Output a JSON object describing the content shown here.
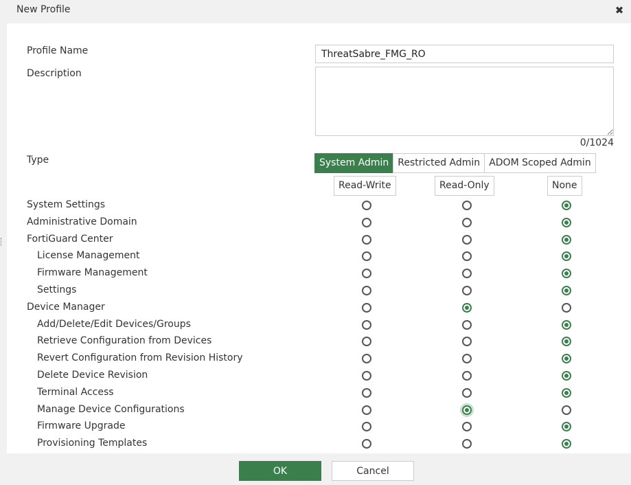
{
  "dialog": {
    "title": "New Profile",
    "close_symbol": "✖"
  },
  "form": {
    "profile_name_label": "Profile Name",
    "profile_name_value": "ThreatSabre_FMG_RO",
    "description_label": "Description",
    "description_value": "",
    "char_counter": "0/1024",
    "type_label": "Type",
    "type_options": [
      "System Admin",
      "Restricted Admin",
      "ADOM Scoped Admin"
    ],
    "type_selected": "System Admin"
  },
  "columns": [
    "Read-Write",
    "Read-Only",
    "None"
  ],
  "permissions": [
    {
      "label": "System Settings",
      "indent": false,
      "value": "None"
    },
    {
      "label": "Administrative Domain",
      "indent": false,
      "value": "None"
    },
    {
      "label": "FortiGuard Center",
      "indent": false,
      "value": "None"
    },
    {
      "label": "License Management",
      "indent": true,
      "value": "None"
    },
    {
      "label": "Firmware Management",
      "indent": true,
      "value": "None"
    },
    {
      "label": "Settings",
      "indent": true,
      "value": "None"
    },
    {
      "label": "Device Manager",
      "indent": false,
      "value": "Read-Only"
    },
    {
      "label": "Add/Delete/Edit Devices/Groups",
      "indent": true,
      "value": "None"
    },
    {
      "label": "Retrieve Configuration from Devices",
      "indent": true,
      "value": "None"
    },
    {
      "label": "Revert Configuration from Revision History",
      "indent": true,
      "value": "None"
    },
    {
      "label": "Delete Device Revision",
      "indent": true,
      "value": "None"
    },
    {
      "label": "Terminal Access",
      "indent": true,
      "value": "None"
    },
    {
      "label": "Manage Device Configurations",
      "indent": true,
      "value": "Read-Only"
    },
    {
      "label": "Firmware Upgrade",
      "indent": true,
      "value": "None"
    },
    {
      "label": "Provisioning Templates",
      "indent": true,
      "value": "None"
    }
  ],
  "footer": {
    "ok_label": "OK",
    "cancel_label": "Cancel"
  },
  "colors": {
    "accent": "#3b7f4d",
    "border": "#cccccc",
    "header_bg": "#f1f1f1"
  }
}
